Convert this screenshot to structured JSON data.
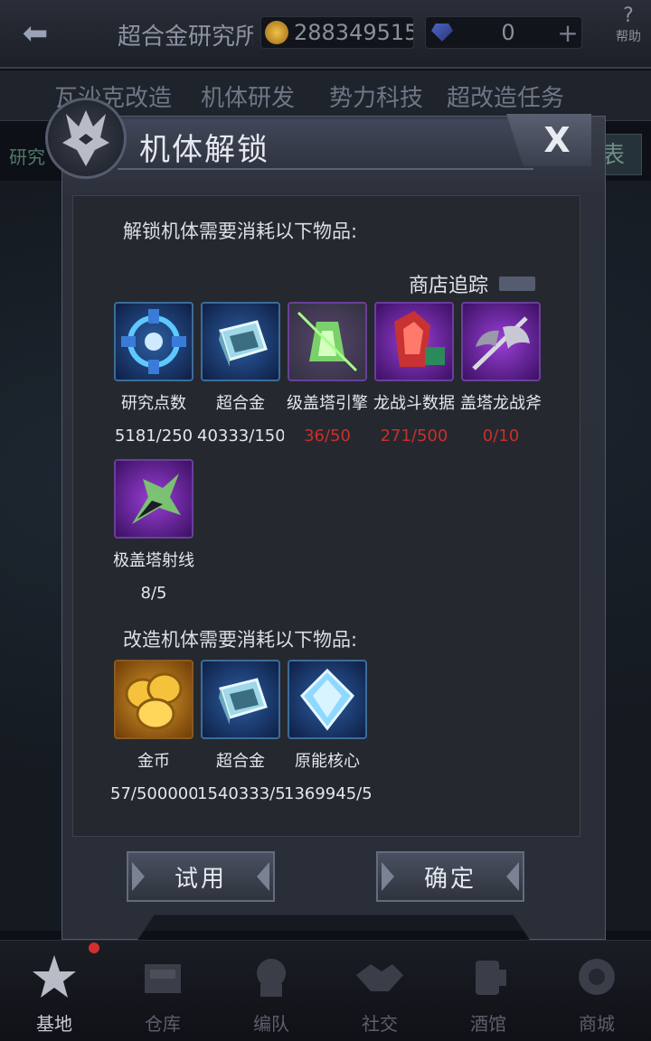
{
  "topbar": {
    "title": "超合金研究所",
    "gold_value": "288349515",
    "gem_value": "0",
    "plus_label": "+",
    "help_label": "帮助"
  },
  "tabs": [
    "瓦沙克改造",
    "机体研发",
    "势力科技",
    "超改造任务"
  ],
  "subbar": {
    "left_text": "研究",
    "right_text": "表"
  },
  "modal": {
    "title": "机体解锁",
    "close_label": "X",
    "unlock_heading": "解锁机体需要消耗以下物品:",
    "shop_track_label": "商店追踪",
    "unlock_items": [
      {
        "name": "研究点数",
        "count": "5181/250",
        "lack": false,
        "icon": "research-points-icon"
      },
      {
        "name": "超合金",
        "count": "40333/150",
        "lack": false,
        "icon": "super-alloy-icon"
      },
      {
        "name": "级盖塔引擎",
        "count": "36/50",
        "lack": true,
        "icon": "getter-engine-icon"
      },
      {
        "name": "龙战斗数据",
        "count": "271/500",
        "lack": true,
        "icon": "dragon-battle-data-icon"
      },
      {
        "name": "盖塔龙战斧",
        "count": "0/10",
        "lack": true,
        "icon": "getter-axe-icon"
      },
      {
        "name": "极盖塔射线",
        "count": "8/5",
        "lack": false,
        "icon": "getter-beam-icon"
      }
    ],
    "modify_heading": "改造机体需要消耗以下物品:",
    "modify_items": [
      {
        "name": "金币",
        "count": "57/500000",
        "lack": false,
        "icon": "gold-coin-icon"
      },
      {
        "name": "超合金",
        "count": "1540333/5",
        "lack": false,
        "icon": "super-alloy-icon"
      },
      {
        "name": "原能核心",
        "count": "1369945/5",
        "lack": false,
        "icon": "energy-core-icon"
      }
    ],
    "try_button": "试用",
    "confirm_button": "确定"
  },
  "bottom_nav": [
    {
      "label": "基地",
      "icon": "base-star-icon",
      "active": true
    },
    {
      "label": "仓库",
      "icon": "warehouse-icon",
      "active": false
    },
    {
      "label": "编队",
      "icon": "formation-icon",
      "active": false
    },
    {
      "label": "社交",
      "icon": "handshake-icon",
      "active": false
    },
    {
      "label": "酒馆",
      "icon": "tavern-icon",
      "active": false
    },
    {
      "label": "商城",
      "icon": "shop-icon",
      "active": false
    }
  ]
}
